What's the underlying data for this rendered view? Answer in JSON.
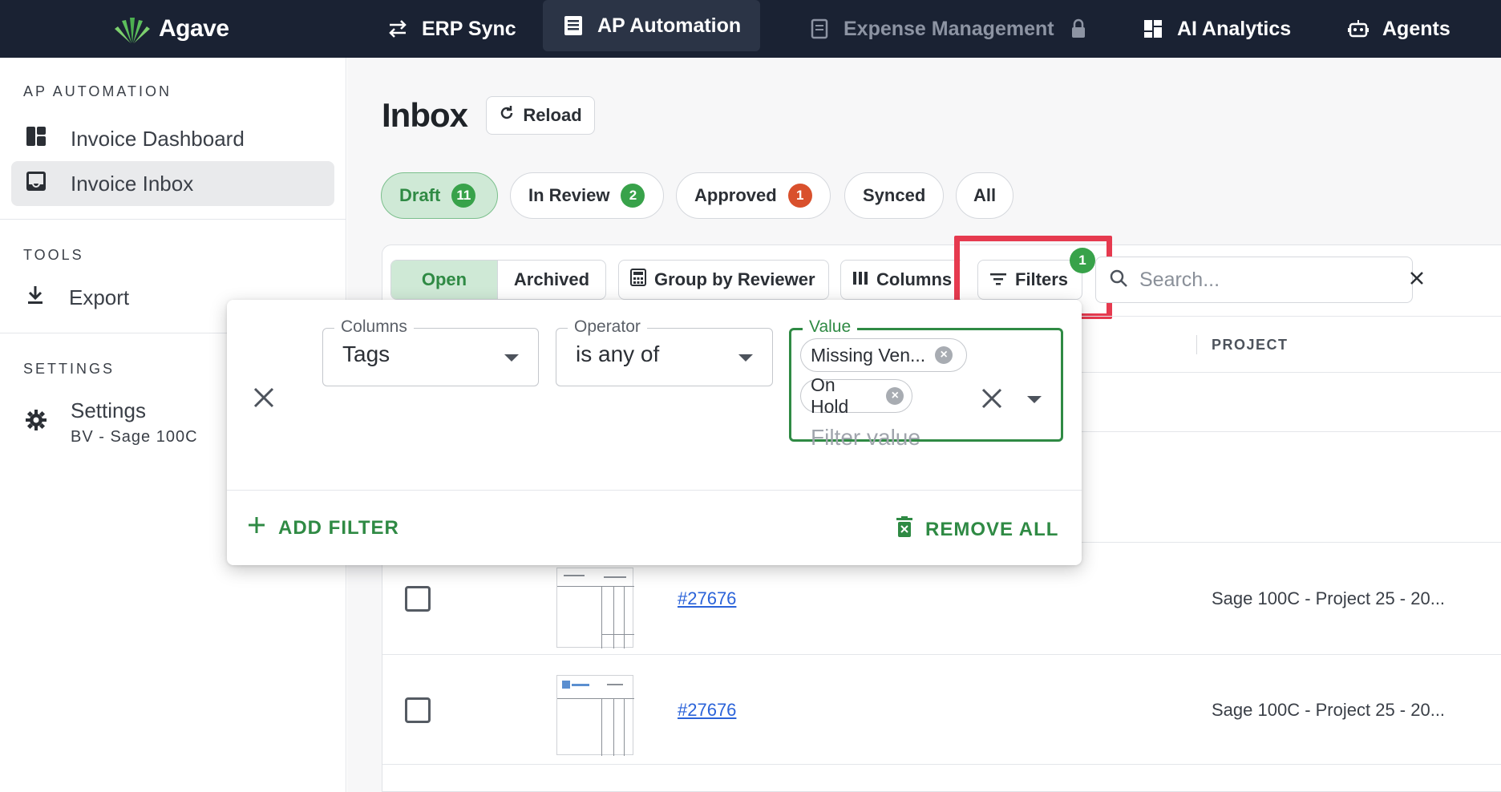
{
  "topbar": {
    "brand": "Agave",
    "nav": [
      {
        "label": "ERP Sync",
        "icon": "swap-arrows-icon"
      },
      {
        "label": "AP Automation",
        "icon": "document-icon"
      },
      {
        "label": "Expense Management",
        "icon": "receipt-icon",
        "locked": true
      },
      {
        "label": "AI Analytics",
        "icon": "dashboard-grid-icon"
      },
      {
        "label": "Agents",
        "icon": "robot-icon"
      }
    ]
  },
  "sidebar": {
    "section_ap": "AP AUTOMATION",
    "items_ap": [
      {
        "label": "Invoice Dashboard",
        "icon": "dashboard-icon"
      },
      {
        "label": "Invoice Inbox",
        "icon": "inbox-icon"
      }
    ],
    "section_tools": "TOOLS",
    "export_label": "Export",
    "section_settings": "SETTINGS",
    "settings_label": "Settings",
    "settings_sub": "BV - Sage 100C"
  },
  "main": {
    "title": "Inbox",
    "reload_label": "Reload",
    "status_chips": [
      {
        "label": "Draft",
        "count": "11"
      },
      {
        "label": "In Review",
        "count": "2"
      },
      {
        "label": "Approved",
        "count": "1"
      },
      {
        "label": "Synced"
      },
      {
        "label": "All"
      }
    ],
    "toggle": {
      "open": "Open",
      "archived": "Archived"
    },
    "group_by_label": "Group by Reviewer",
    "columns_label": "Columns",
    "filters_label": "Filters",
    "filters_count": "1",
    "search_placeholder": "Search...",
    "table": {
      "project_header": "PROJECT",
      "rows": [
        {
          "invoice": "#27676",
          "project": "Sage 100C - Project 25 - 20..."
        },
        {
          "invoice": "#27676",
          "project": "Sage 100C - Project 25 - 20..."
        }
      ]
    }
  },
  "filter_popup": {
    "columns_legend": "Columns",
    "columns_value": "Tags",
    "operator_legend": "Operator",
    "operator_value": "is any of",
    "value_legend": "Value",
    "tags": [
      "Missing Ven...",
      "On Hold"
    ],
    "value_placeholder": "Filter value",
    "add_filter_label": "ADD FILTER",
    "remove_all_label": "REMOVE ALL"
  },
  "colors": {
    "topbar_bg": "#1a2233",
    "accent_green": "#2f8a44",
    "active_chip_bg": "#cfe9d6",
    "badge_red": "#d9502c",
    "highlight_red": "#e63a4f",
    "link_blue": "#2b63d9"
  }
}
